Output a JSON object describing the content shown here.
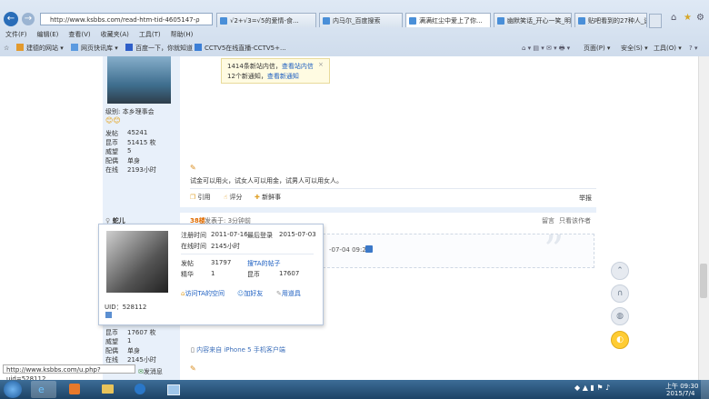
{
  "browser": {
    "address": "http://www.ksbbs.com/read-htm-tid-4605147-ρ",
    "tabs": [
      "√2+√3=√5的爱情-食...",
      "内马尔_百度搜索",
      "满满红尘中爱上了你...",
      "幽默笑话_开心一笑_明...",
      "贴吧看到的27种人_逃..."
    ],
    "menu": [
      "文件(F)",
      "编辑(E)",
      "查看(V)",
      "收藏夹(A)",
      "工具(T)",
      "帮助(H)"
    ],
    "favorites": [
      "建德的网站 ▾",
      "网页快讯库 ▾",
      "百度一下，你就知道",
      "CCTV5在线直播-CCTV5+..."
    ],
    "toolbar_right": [
      "页面(P) ▾",
      "安全(S) ▾",
      "工具(O) ▾"
    ],
    "status_url": "http://www.ksbbs.com/u.php?uid=528112"
  },
  "notification": {
    "line1": "1414条新站内信，",
    "line1_link": "查看站内信",
    "line2": "12个新通知，",
    "line2_link": "查看新通知",
    "close": "×"
  },
  "post1": {
    "level": "级别: 本乡理事会",
    "stats": [
      {
        "label": "发帖",
        "value": "45241"
      },
      {
        "label": "昆币",
        "value": "51415 枚"
      },
      {
        "label": "威望",
        "value": "5"
      },
      {
        "label": "配偶",
        "value": "单身"
      },
      {
        "label": "在线",
        "value": "2193小时"
      }
    ],
    "signature": "试金可以用火，试女人可以用金，试男人可以用女人。",
    "actions": [
      "引用",
      "评分",
      "新鲜事"
    ],
    "report": "举报"
  },
  "post2": {
    "author": "蛇儿",
    "floor": "38楼",
    "posted": "发表于: 3分钟前",
    "right_links": [
      "留言",
      "只看该作者"
    ],
    "quote_time": "-07-04 09:24)",
    "client_line": "内容来自 iPhone 5 手机客户端",
    "uid": "UID：528112",
    "stats": [
      {
        "label": "昆币",
        "value": "17607 枚"
      },
      {
        "label": "威望",
        "value": "1"
      },
      {
        "label": "配偶",
        "value": "单身"
      },
      {
        "label": "在线",
        "value": "2145小时"
      }
    ],
    "msg_btn": "发消息"
  },
  "card": {
    "reg_label": "注册时间",
    "reg_value": "2011-07-16",
    "last_label": "最后登录",
    "last_value": "2015-07-03",
    "online_label": "在线时间",
    "online_value": "2145小时",
    "posts_label": "发帖",
    "posts_value": "31797",
    "her_posts": "搜TA的帖子",
    "essence_label": "精华",
    "essence_value": "1",
    "coins_label": "昆币",
    "coins_value": "17607",
    "actions": [
      "访问TA的空间",
      "加好友",
      "用道具"
    ]
  },
  "clock": {
    "time": "上午 09:30",
    "date": "2015/7/4"
  },
  "colors": {
    "accent": "#1a5dc0",
    "floor": "#e06c00",
    "sidebar": "#e8f0fa"
  }
}
